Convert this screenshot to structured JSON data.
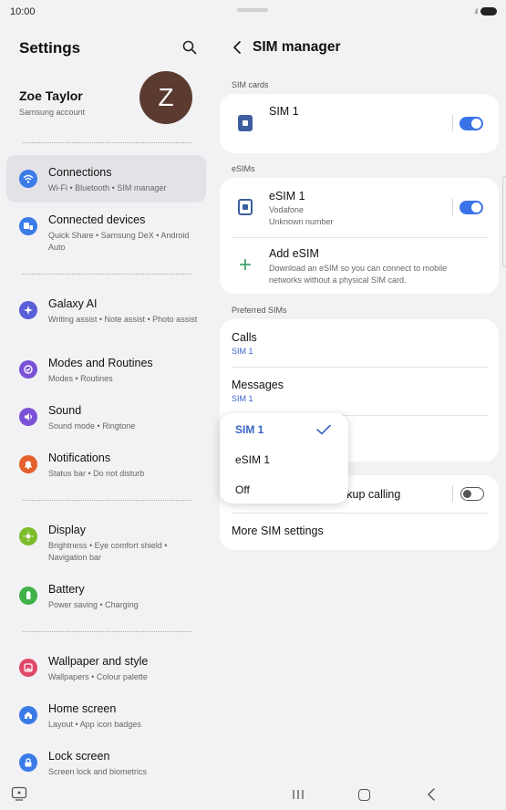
{
  "status_bar": {
    "time": "10:00"
  },
  "left_pane": {
    "title": "Settings",
    "profile": {
      "name": "Zoe Taylor",
      "subtitle": "Samsung account",
      "avatar_letter": "Z"
    },
    "items": [
      {
        "title": "Connections",
        "subtitle": "Wi-Fi • Bluetooth • SIM manager",
        "icon": "wifi-icon",
        "color": "#3b7be8",
        "active": true
      },
      {
        "title": "Connected devices",
        "subtitle": "Quick Share • Samsung DeX • Android Auto",
        "icon": "devices-icon",
        "color": "#3b7be8"
      },
      {
        "title": "Galaxy AI",
        "subtitle": "Writing assist • Note assist • Photo assist",
        "icon": "sparkle-icon",
        "color": "#5a5fd8"
      },
      {
        "title": "Modes and Routines",
        "subtitle": "Modes • Routines",
        "icon": "routine-icon",
        "color": "#7b52d6"
      },
      {
        "title": "Sound",
        "subtitle": "Sound mode • Ringtone",
        "icon": "speaker-icon",
        "color": "#7b52d6"
      },
      {
        "title": "Notifications",
        "subtitle": "Status bar • Do not disturb",
        "icon": "bell-icon",
        "color": "#e5602c"
      },
      {
        "title": "Display",
        "subtitle": "Brightness • Eye comfort shield • Navigation bar",
        "icon": "sun-icon",
        "color": "#7dbd2c"
      },
      {
        "title": "Battery",
        "subtitle": "Power saving • Charging",
        "icon": "battery-icon",
        "color": "#3fb24a"
      },
      {
        "title": "Wallpaper and style",
        "subtitle": "Wallpapers • Colour palette",
        "icon": "wallpaper-icon",
        "color": "#e0476a"
      },
      {
        "title": "Home screen",
        "subtitle": "Layout • App icon badges",
        "icon": "home-icon",
        "color": "#3b7be8"
      },
      {
        "title": "Lock screen",
        "subtitle": "Screen lock and biometrics",
        "icon": "lock-icon",
        "color": "#3b7be8"
      }
    ]
  },
  "right_pane": {
    "title": "SIM manager",
    "sim_cards_header": "SIM cards",
    "sim1": {
      "name": "SIM 1",
      "enabled": true
    },
    "esims_header": "eSIMs",
    "esim1": {
      "name": "eSIM 1",
      "carrier": "Vodafone",
      "number": "Unknown number",
      "enabled": true
    },
    "add_esim": {
      "title": "Add eSIM",
      "description": "Download an eSIM so you can connect to mobile networks without a physical SIM card."
    },
    "preferred_header": "Preferred SIMs",
    "calls": {
      "title": "Calls",
      "value": "SIM 1"
    },
    "messages": {
      "title": "Messages",
      "value": "SIM 1"
    },
    "backup_calling": {
      "title_visible": "ckup calling",
      "enabled": false
    },
    "more_settings": "More SIM settings"
  },
  "dropdown": {
    "options": [
      "SIM 1",
      "eSIM 1",
      "Off"
    ],
    "selected": "SIM 1"
  },
  "colors": {
    "accent": "#3a73e8",
    "selected_text": "#3a63c7",
    "avatar_bg": "#5b3a30"
  }
}
